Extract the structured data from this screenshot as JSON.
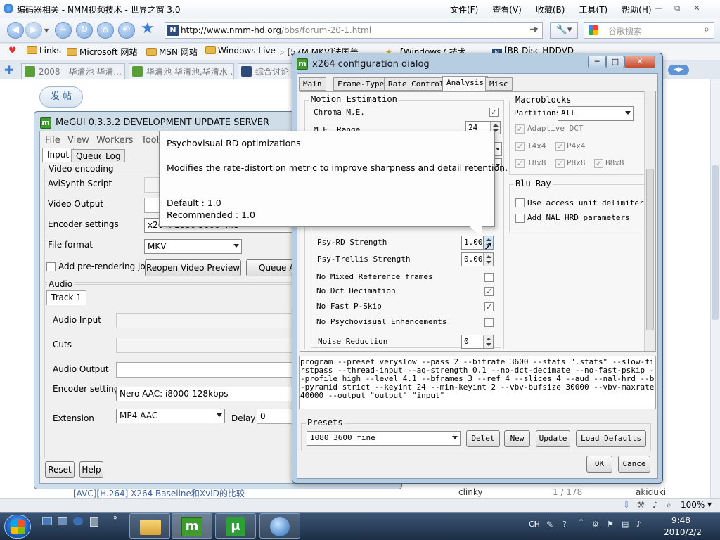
{
  "browser": {
    "title": "编码器相关 - NMM视频技术 - 世界之窗 3.0",
    "menu": [
      "文件(F)",
      "查看(V)",
      "收藏(B)",
      "工具(T)",
      "帮助(H)"
    ],
    "url_prefix": "http://www.nmm-hd.org",
    "url_path": "/bbs/forum-20-1.html",
    "search_placeholder": "谷歌搜索",
    "favorites": [
      "Links",
      "Microsoft 网站",
      "MSN 网站",
      "Windows Live",
      "[57M MKV]法国美",
      "【Windows7 技术",
      "[BR Disc HDDVD"
    ],
    "tabs": [
      "2008 - 华清池 华清...",
      "华清池 华清池,华清水...",
      "综合讨论"
    ],
    "zoom": "100%"
  },
  "page": {
    "post_button": "发 帖",
    "bottom_row": [
      "[AVC][H.264] X264 Baseline和XviD的比较",
      "clinky",
      "1 / 178",
      "akiduki"
    ]
  },
  "megui": {
    "title": "MeGUI 0.3.3.2 DEVELOPMENT UPDATE SERVER",
    "menu": [
      "File",
      "View",
      "Workers",
      "Tools"
    ],
    "tabs": [
      "Input",
      "Queue",
      "Log"
    ],
    "video_group": "Video encoding",
    "avisynth_label": "AviSynth Script",
    "video_output_label": "Video Output",
    "encoder_settings_label": "Encoder settings",
    "encoder_settings_value": "x264: 1080 3600 fine",
    "file_format_label": "File format",
    "file_format_value": "MKV",
    "prerender_label": "Add pre-rendering job",
    "reopen_button": "Reopen Video Preview",
    "queue_button": "Queue An",
    "audio_group": "Audio",
    "track_tab": "Track 1",
    "audio_input_label": "Audio Input",
    "cuts_label": "Cuts",
    "audio_output_label": "Audio Output",
    "audio_encoder_label": "Encoder settings",
    "audio_encoder_value": "Nero AAC: i8000-128kbps",
    "extension_label": "Extension",
    "extension_value": "MP4-AAC",
    "delay_label": "Delay",
    "delay_value": "0",
    "reset_button": "Reset",
    "help_button": "Help"
  },
  "x264": {
    "title": "x264 configuration dialog",
    "tabs": [
      "Main",
      "Frame-Type",
      "Rate Control",
      "Analysis",
      "Misc"
    ],
    "motion_group": "Motion Estimation",
    "chroma_me_label": "Chroma M.E.",
    "chroma_me_checked": true,
    "me_range_label": "M.E. Range",
    "me_range_value": "24",
    "psy_rd_label": "Psy-RD Strength",
    "psy_rd_value": "1.00",
    "psy_trellis_label": "Psy-Trellis Strength",
    "psy_trellis_value": "0.00",
    "no_mixed_refs_label": "No Mixed Reference frames",
    "no_mixed_refs_checked": false,
    "no_dct_decimation_label": "No Dct Decimation",
    "no_dct_decimation_checked": true,
    "no_fast_pskip_label": "No Fast P-Skip",
    "no_fast_pskip_checked": true,
    "no_psy_label": "No Psychovisual Enhancements",
    "no_psy_checked": false,
    "noise_reduction_label": "Noise Reduction",
    "noise_reduction_value": "0",
    "macroblocks_group": "Macroblocks",
    "partitions_label": "Partitions",
    "partitions_value": "All",
    "adaptive_dct_label": "Adaptive DCT",
    "i4x4_label": "I4x4",
    "p4x4_label": "P4x4",
    "i8x8_label": "I8x8",
    "p8x8_label": "P8x8",
    "b8x8_label": "B8x8",
    "bluray_group": "Blu-Ray",
    "aud_label": "Use access unit delimiters",
    "nal_hrd_label": "Add NAL HRD parameters",
    "command_line": "program --preset veryslow --pass 2 --bitrate 3600 --stats \".stats\" --slow-firstpass --thread-input --aq-strength 0.1 --no-dct-decimate --no-fast-pskip --profile high --level 4.1 --bframes 3 --ref 4 --slices 4 --aud --nal-hrd --b-pyramid strict --keyint 24 --min-keyint 2 --vbv-bufsize 30000 --vbv-maxrate 40000 --output \"output\" \"input\"",
    "presets_group": "Presets",
    "preset_value": "1080 3600 fine",
    "delete_button": "Delet",
    "new_button": "New",
    "update_button": "Update",
    "load_defaults_button": "Load Defaults",
    "ok_button": "OK",
    "cancel_button": "Cance"
  },
  "tooltip": {
    "title": "Psychovisual RD optimizations",
    "description": "Modifies the rate-distortion metric to improve sharpness and detail retention.",
    "default": "Default : 1.0",
    "recommended": "Recommended : 1.0"
  },
  "taskbar": {
    "time": "9:48",
    "date": "2010/2/2",
    "lang": "CH"
  },
  "colors": {
    "win_frame": "#b7cde2",
    "dialog_bg": "#f0f0f0",
    "taskbar": "#1b2e45",
    "link_blue": "#2c5a8a"
  }
}
